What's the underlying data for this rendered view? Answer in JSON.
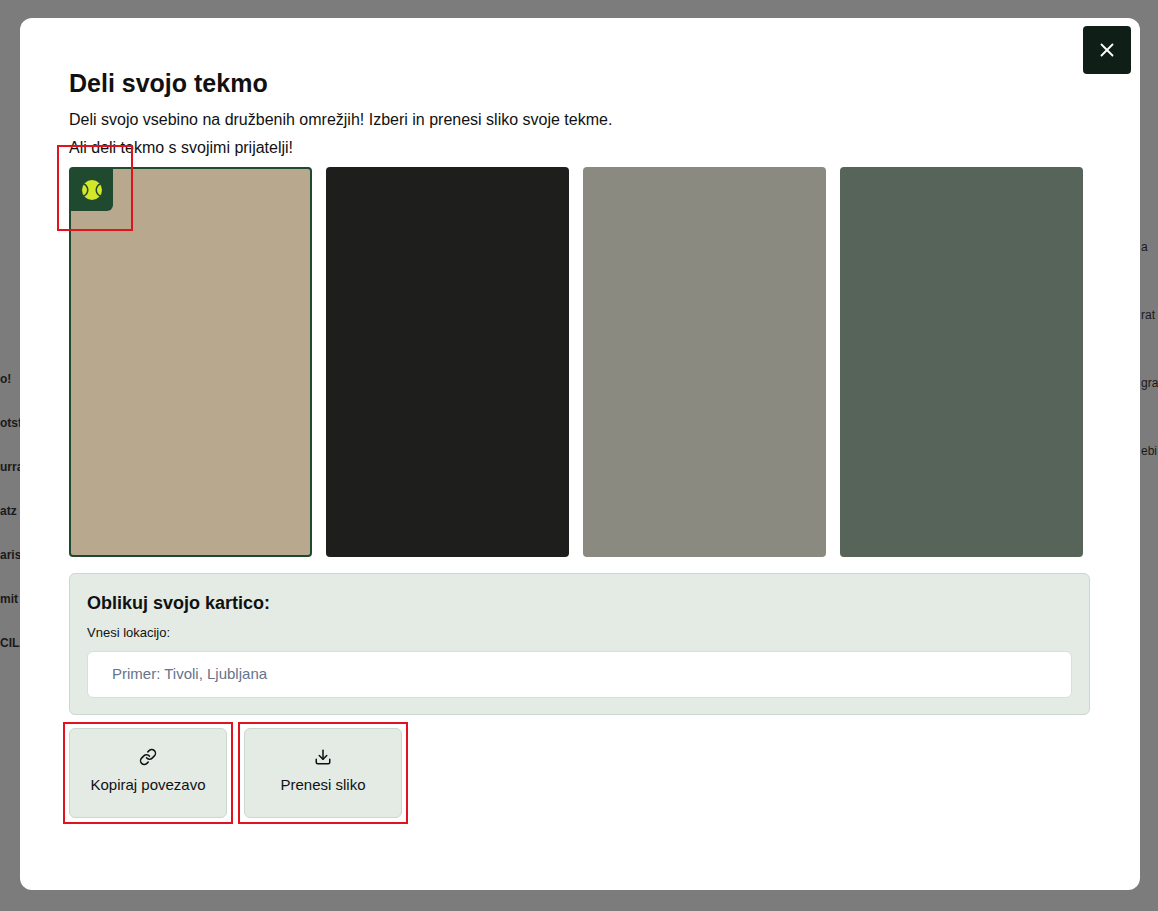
{
  "background": {
    "left_fragments": [
      "o!",
      "otsf",
      "urra",
      "atz",
      "arist",
      "mit",
      "CILA"
    ],
    "right_fragments": [
      "a",
      "rat",
      "gra",
      "ebi"
    ]
  },
  "dialog": {
    "title": "Deli svojo tekmo",
    "description": [
      "Deli svojo vsebino na družbenih omrežjih! Izberi in prenesi sliko svoje tekme.",
      "Ali deli tekmo s svojimi prijatelji!"
    ]
  },
  "templates": [
    {
      "selected": true,
      "highlighted": true,
      "color": "#b8a98e"
    },
    {
      "selected": false,
      "highlighted": false,
      "color": "#1e1f1c"
    },
    {
      "selected": false,
      "highlighted": false,
      "color": "#8a8a80"
    },
    {
      "selected": false,
      "highlighted": false,
      "color": "#56645a"
    }
  ],
  "customize": {
    "title": "Oblikuj svojo kartico:",
    "location_label": "Vnesi lokacijo:",
    "location_placeholder": "Primer: Tivoli, Ljubljana",
    "location_value": ""
  },
  "buttons": [
    {
      "label": "Kopiraj povezavo",
      "kind": "link",
      "highlighted": true
    },
    {
      "label": "Prenesi sliko",
      "kind": "download",
      "highlighted": true
    }
  ]
}
